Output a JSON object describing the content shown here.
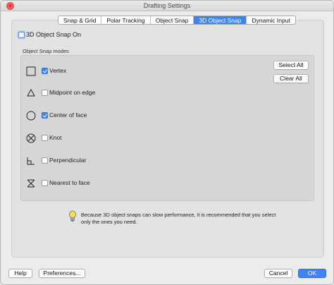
{
  "window": {
    "title": "Drafting Settings"
  },
  "tabs": [
    {
      "label": "Snap & Grid"
    },
    {
      "label": "Polar Tracking"
    },
    {
      "label": "Object Snap"
    },
    {
      "label": "3D Object Snap"
    },
    {
      "label": "Dynamic Input"
    }
  ],
  "active_tab": "3D Object Snap",
  "snap_on": {
    "label": "3D Object Snap On",
    "checked": false
  },
  "modes_group": {
    "label": "Object Snap modes"
  },
  "modes": [
    {
      "label": "Vertex",
      "checked": true,
      "icon": "square-icon"
    },
    {
      "label": "Midpoint on edge",
      "checked": false,
      "icon": "triangle-icon"
    },
    {
      "label": "Center of face",
      "checked": true,
      "icon": "circle-icon"
    },
    {
      "label": "Knot",
      "checked": false,
      "icon": "circle-x-icon"
    },
    {
      "label": "Perpendicular",
      "checked": false,
      "icon": "perpendicular-icon"
    },
    {
      "label": "Nearest to face",
      "checked": false,
      "icon": "hourglass-icon"
    }
  ],
  "buttons": {
    "select_all": "Select All",
    "clear_all": "Clear All",
    "help": "Help",
    "preferences": "Preferences...",
    "cancel": "Cancel",
    "ok": "OK"
  },
  "note": {
    "icon": "lightbulb-icon",
    "text": "Because 3D object snaps can slow performance, it is recommended that you select only the ones you need."
  },
  "colors": {
    "accent": "#3b86f7",
    "close": "#ff5f57"
  }
}
